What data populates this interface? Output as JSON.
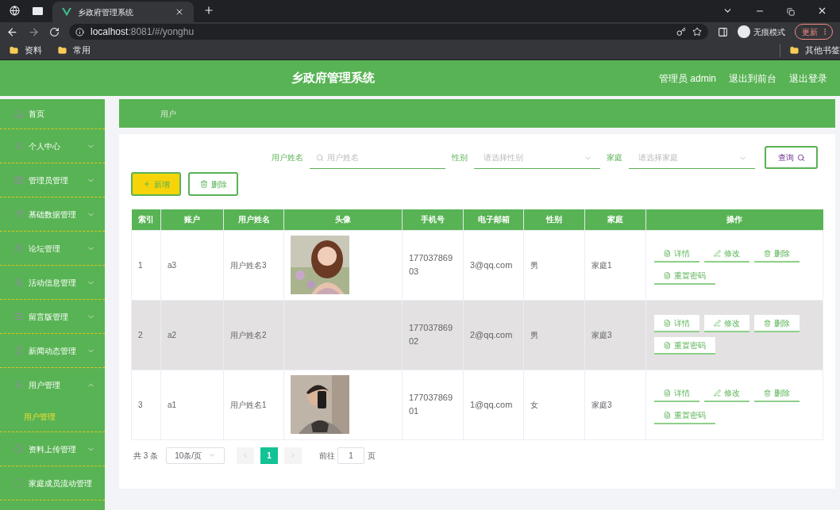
{
  "browser": {
    "tab_title": "乡政府管理系统",
    "url_host": "localhost",
    "url_rest": ":8081/#/yonghu",
    "profile_label": "无痕模式",
    "update_button": "更新",
    "bookmarks": [
      "资料",
      "常用"
    ],
    "other_bookmarks": "其他书签"
  },
  "header": {
    "title": "乡政府管理系统",
    "user": "管理员 admin",
    "links": [
      "退出到前台",
      "退出登录"
    ]
  },
  "sidebar": {
    "items": [
      {
        "label": "首页"
      },
      {
        "label": "个人中心",
        "expanded": false
      },
      {
        "label": "管理员管理",
        "expanded": false
      },
      {
        "label": "基础数据管理",
        "expanded": false
      },
      {
        "label": "论坛管理",
        "expanded": false
      },
      {
        "label": "活动信息管理",
        "expanded": false
      },
      {
        "label": "留言版管理",
        "expanded": false
      },
      {
        "label": "新闻动态管理",
        "expanded": false
      },
      {
        "label": "用户管理",
        "expanded": true,
        "children": [
          {
            "label": "用户管理",
            "selected": true
          }
        ]
      },
      {
        "label": "资料上传管理",
        "expanded": false
      },
      {
        "label": "家庭成员流动管理"
      }
    ]
  },
  "breadcrumb": "用户",
  "search": {
    "fields": [
      {
        "kind": "text",
        "label": "用户姓名",
        "placeholder": "用户姓名"
      },
      {
        "kind": "select",
        "label": "性别",
        "placeholder": "请选择性别"
      },
      {
        "kind": "select",
        "label": "家庭",
        "placeholder": "请选择家庭"
      }
    ],
    "button": "查询"
  },
  "actions": [
    {
      "kind": "add",
      "label": "新增"
    },
    {
      "kind": "delete",
      "label": "删除"
    }
  ],
  "table": {
    "columns": [
      "索引",
      "账户",
      "用户姓名",
      "头像",
      "手机号",
      "电子邮箱",
      "性别",
      "家庭",
      "操作"
    ],
    "rows": [
      {
        "index": "1",
        "account": "a3",
        "name": "用户姓名3",
        "has_avatar": true,
        "phone": "17703786903",
        "email": "3@qq.com",
        "gender": "男",
        "family": "家庭1",
        "highlighted": false,
        "actions": [
          {
            "kind": "detail",
            "label": "详情"
          },
          {
            "kind": "edit",
            "label": "修改"
          },
          {
            "kind": "delete",
            "label": "删除"
          },
          {
            "kind": "detail",
            "label": "重置密码"
          }
        ]
      },
      {
        "index": "2",
        "account": "a2",
        "name": "用户姓名2",
        "has_avatar": false,
        "phone": "17703786902",
        "email": "2@qq.com",
        "gender": "男",
        "family": "家庭3",
        "highlighted": true,
        "actions": [
          {
            "kind": "detail",
            "label": "详情"
          },
          {
            "kind": "edit",
            "label": "修改"
          },
          {
            "kind": "delete",
            "label": "删除"
          },
          {
            "kind": "detail",
            "label": "重置密码"
          }
        ]
      },
      {
        "index": "3",
        "account": "a1",
        "name": "用户姓名1",
        "has_avatar": true,
        "phone": "17703786901",
        "email": "1@qq.com",
        "gender": "女",
        "family": "家庭3",
        "highlighted": false,
        "actions": [
          {
            "kind": "detail",
            "label": "详情"
          },
          {
            "kind": "edit",
            "label": "修改"
          },
          {
            "kind": "delete",
            "label": "删除"
          },
          {
            "kind": "detail",
            "label": "重置密码"
          }
        ]
      }
    ]
  },
  "pagination": {
    "total": "共 3 条",
    "page_size": "10条/页",
    "pages": [
      {
        "label": "1",
        "selected": true
      }
    ],
    "goto_label": "前往",
    "goto_value": "1",
    "page_suffix": "页"
  }
}
